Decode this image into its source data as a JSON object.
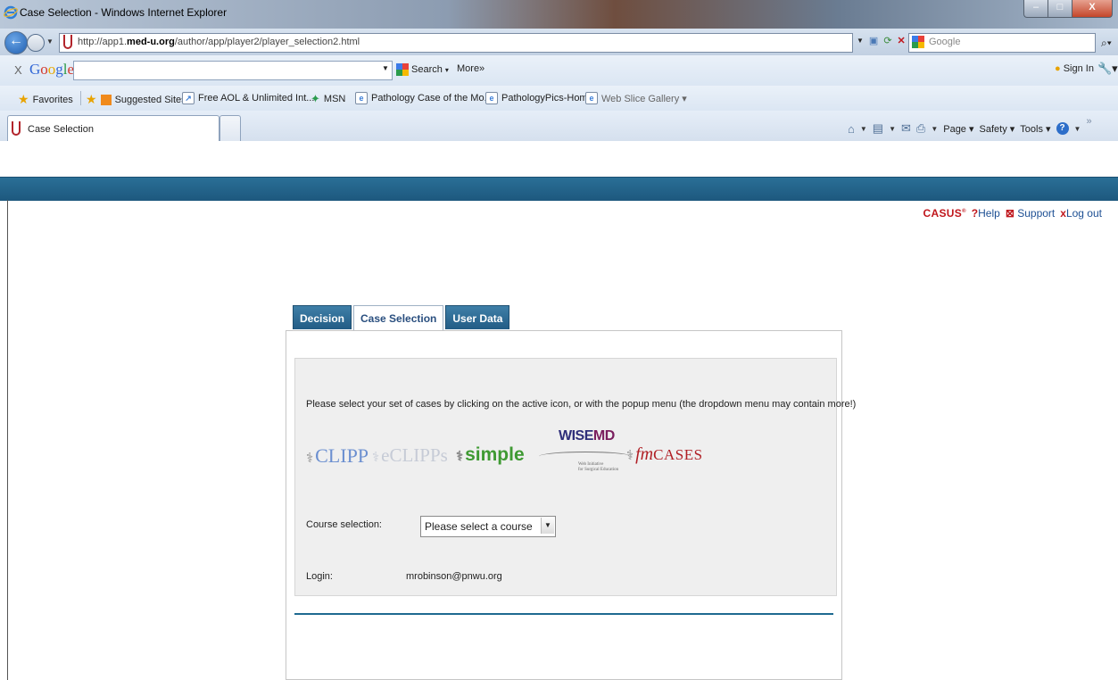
{
  "window": {
    "title": "Case Selection - Windows Internet Explorer",
    "controls": {
      "minimize": "–",
      "maximize": "□",
      "close": "X"
    }
  },
  "address_bar": {
    "url_prefix": "http://app1.",
    "url_domain": "med-u.org",
    "url_path": "/author/app/player2/player_selection2.html"
  },
  "browser_search": {
    "placeholder": "Google"
  },
  "google_toolbar": {
    "close": "X",
    "logo": {
      "G": "G",
      "o1": "o",
      "o2": "o",
      "g": "g",
      "l": "l",
      "e": "e"
    },
    "search_label": "Search",
    "more_label": "More»",
    "signin_label": "Sign In"
  },
  "favorites_bar": {
    "favorites_label": "Favorites",
    "items": [
      {
        "label": "Suggested Sites ▾"
      },
      {
        "label": "Free AOL & Unlimited Int..."
      },
      {
        "label": "MSN"
      },
      {
        "label": "Pathology Case of the Mo..."
      },
      {
        "label": "PathologyPics-Home"
      },
      {
        "label": "Web Slice Gallery ▾"
      }
    ]
  },
  "tabs": {
    "active_title": "Case Selection"
  },
  "command_bar": {
    "page": "Page ▾",
    "safety": "Safety ▾",
    "tools": "Tools ▾"
  },
  "header_links": {
    "brand": "CASUS",
    "help": "Help",
    "support": "Support",
    "logout": "Log out"
  },
  "app_tabs": [
    {
      "label": "Decision",
      "active": false
    },
    {
      "label": "Case Selection",
      "active": true
    },
    {
      "label": "User Data",
      "active": false
    }
  ],
  "content": {
    "instructions": "Please select your set of cases by clicking on the active icon, or with the popup menu (the dropdown menu may contain more!)",
    "brands": {
      "clipp": "CLIPP",
      "eclipps": "eCLIPPs",
      "simple": "simple",
      "wisemd_wise": "WISE",
      "wisemd_md": "MD",
      "wisemd_tag_1": "Web Initiative",
      "wisemd_tag_2": "for Surgical Education",
      "fm": "fm",
      "cases": "CASES"
    },
    "course_label": "Course selection:",
    "course_value": "Please select a course",
    "login_label": "Login:",
    "login_value": "mrobinson@pnwu.org"
  }
}
